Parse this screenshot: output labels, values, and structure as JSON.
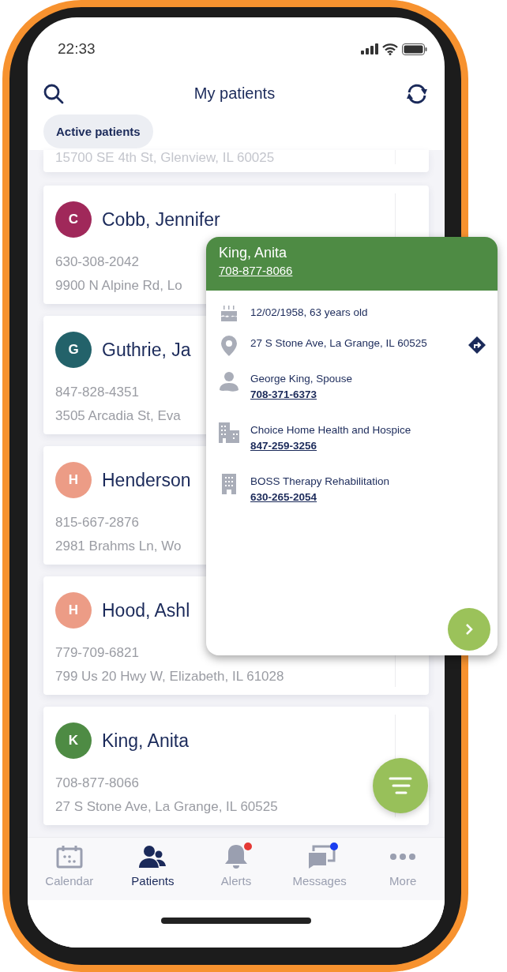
{
  "status_bar": {
    "time": "22:33"
  },
  "header": {
    "title": "My patients"
  },
  "filter_chip": {
    "label": "Active patients"
  },
  "partial_card": {
    "address": "15700 SE 4th St, Glenview, IL 60025"
  },
  "patients": [
    {
      "initial": "C",
      "color": "#a0285a",
      "name": "Cobb, Jennifer",
      "phone": "630-308-2042",
      "address": "9900 N Alpine Rd, Lo"
    },
    {
      "initial": "G",
      "color": "#23626a",
      "name": "Guthrie, Ja",
      "phone": "847-828-4351",
      "address": "3505 Arcadia St, Eva"
    },
    {
      "initial": "H",
      "color": "#ec9c86",
      "name": "Henderson",
      "phone": "815-667-2876",
      "address": "2981 Brahms Ln, Wo"
    },
    {
      "initial": "H",
      "color": "#ec9c86",
      "name": "Hood, Ashl",
      "phone": "779-709-6821",
      "address": "799 Us 20 Hwy W, Elizabeth, IL 61028"
    },
    {
      "initial": "K",
      "color": "#4e8b44",
      "name": "King, Anita",
      "phone": "708-877-8066",
      "address": "27 S Stone Ave, La Grange, IL 60525"
    }
  ],
  "popup": {
    "name": "King, Anita",
    "phone": "708-877-8066",
    "rows": [
      {
        "kind": "birthday",
        "text": "12/02/1958, 63 years old"
      },
      {
        "kind": "address",
        "text": "27 S Stone Ave, La Grange, IL 60525"
      },
      {
        "kind": "contact",
        "text": "George King, Spouse",
        "phone": "708-371-6373"
      },
      {
        "kind": "agency",
        "text": "Choice Home Health and Hospice",
        "phone": "847-259-3256"
      },
      {
        "kind": "facility",
        "text": "BOSS Therapy Rehabilitation",
        "phone": "630-265-2054"
      }
    ]
  },
  "tabs": [
    {
      "kind": "calendar",
      "label": "Calendar",
      "selected": false
    },
    {
      "kind": "patients",
      "label": "Patients",
      "selected": true
    },
    {
      "kind": "alerts",
      "label": "Alerts",
      "selected": false,
      "badge": {
        "color": "#e53935"
      }
    },
    {
      "kind": "messages",
      "label": "Messages",
      "selected": false,
      "badge": {
        "color": "#1a3ef0"
      }
    },
    {
      "kind": "more",
      "label": "More",
      "selected": false
    }
  ]
}
